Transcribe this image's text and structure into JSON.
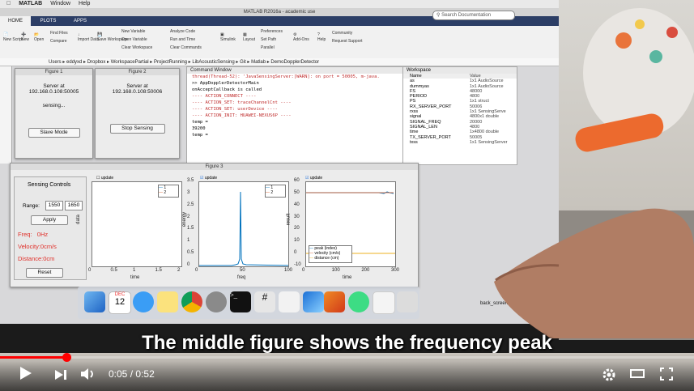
{
  "mac_menu": {
    "app": "MATLAB",
    "items": [
      "Window",
      "Help"
    ]
  },
  "matlab": {
    "title": "MATLAB R2016a - academic use",
    "tabs": [
      "HOME",
      "PLOTS",
      "APPS"
    ],
    "search_placeholder": "Search Documentation",
    "ribbon": {
      "new_script": "New Script",
      "new": "New",
      "open": "Open",
      "compare": "Compare",
      "find_files": "Find Files",
      "import": "Import Data",
      "save": "Save Workspace",
      "new_variable": "New Variable",
      "open_variable": "Open Variable",
      "clear_workspace": "Clear Workspace",
      "analyze_code": "Analyze Code",
      "run_and_time": "Run and Time",
      "clear_commands": "Clear Commands",
      "simulink": "Simulink",
      "layout": "Layout",
      "preferences": "Preferences",
      "set_path": "Set Path",
      "parallel": "Parallel",
      "add_ons": "Add-Ons",
      "help": "Help",
      "community": "Community",
      "request_support": "Request Support"
    },
    "path": "Users ▸ eddyxd ▸ Dropbox ▸ WorkspacePartial ▸ ProjectRunning ▸ LibAcousticSensing ▸ Git ▸ Matlab ▸ DemoDopplerDetector",
    "command_window": {
      "title": "Command Window",
      "lines": [
        "thread(Thread-52): 'JavaSensingServer:[WARN]: on port = 50005, m-java.",
        ">> AppDopplerDetectorMain",
        "   onAcceptCallback is called",
        "---- ACTION_CONNECT ----",
        "---- ACTION_SET: traceChannelCnt ----",
        "---- ACTION_SET: userDevice ----",
        "---- ACTION_INIT: HUAWEI-NEXUS6P ----",
        "",
        "temp =",
        "",
        "      39200",
        "",
        "temp ="
      ]
    },
    "workspace": {
      "title": "Workspace",
      "header_name": "Name",
      "header_value": "Value",
      "rows": [
        {
          "name": "as",
          "value": "1x1 AudioSource"
        },
        {
          "name": "dummyas",
          "value": "1x1 AudioSource"
        },
        {
          "name": "FS",
          "value": "48000"
        },
        {
          "name": "PERIOD",
          "value": "4800"
        },
        {
          "name": "PS",
          "value": "1x1 struct"
        },
        {
          "name": "RX_SERVER_PORT",
          "value": "50006"
        },
        {
          "name": "rxss",
          "value": "1x1 SensingServe"
        },
        {
          "name": "signal",
          "value": "4800x1 double"
        },
        {
          "name": "SIGNAL_FREQ",
          "value": "20000"
        },
        {
          "name": "SIGNAL_LEN",
          "value": "4800"
        },
        {
          "name": "time",
          "value": "1x4800 double"
        },
        {
          "name": "TX_SERVER_PORT",
          "value": "50005"
        },
        {
          "name": "txss",
          "value": "1x1 SensingServer"
        }
      ]
    }
  },
  "figure1": {
    "title": "Figure 1",
    "server_label": "Server at",
    "address": "192.168.0.108:50005",
    "status": "sensing...",
    "button": "Slave Mode"
  },
  "figure2": {
    "title": "Figure 2",
    "server_label": "Server at",
    "address": "192.168.0.108:50006",
    "button": "Stop Sensing"
  },
  "figure3": {
    "title": "Figure 3",
    "controls": {
      "heading": "Sensing Controls",
      "range_label": "Range:",
      "range_min": "1550",
      "range_max": "1650",
      "apply": "Apply",
      "freq_label": "Freq:",
      "freq_value": "0Hz",
      "velocity": "Velocity:0cm/s",
      "distance": "Distance:0cm",
      "reset": "Reset"
    },
    "update_label": "update",
    "plot1": {
      "ylabel": "data",
      "xlabel": "time",
      "legend": [
        "1",
        "2"
      ],
      "xticks": [
        "0",
        "0.5",
        "1",
        "1.5",
        "2"
      ]
    },
    "plot2": {
      "ylabel": "energy",
      "xlabel": "freq",
      "legend": [
        "1",
        "2"
      ],
      "xticks": [
        "0",
        "50",
        "100"
      ],
      "yticks": [
        "3.5",
        "3",
        "2.5",
        "2",
        "1.5",
        "1",
        "0.5",
        "0"
      ]
    },
    "plot3": {
      "ylabel": "result",
      "xlabel": "time",
      "legend": [
        "peak (index)",
        "velocity (cm/s)",
        "distance (cm)"
      ],
      "xticks": [
        "0",
        "100",
        "200",
        "300"
      ],
      "yticks": [
        "60",
        "50",
        "40",
        "30",
        "20",
        "10",
        "0",
        "-10"
      ]
    }
  },
  "dock": {
    "calendar_month": "DEC",
    "calendar_day": "12",
    "folder_label": "back_screen"
  },
  "caption": "The middle figure shows the frequency peak",
  "player": {
    "current_time": "0:05",
    "separator": "/",
    "duration": "0:52",
    "progress": 0.096
  },
  "colors": {
    "accent": "#ff0000",
    "ribbon_blue": "#2c3e66",
    "freq_text": "#e0302a"
  }
}
